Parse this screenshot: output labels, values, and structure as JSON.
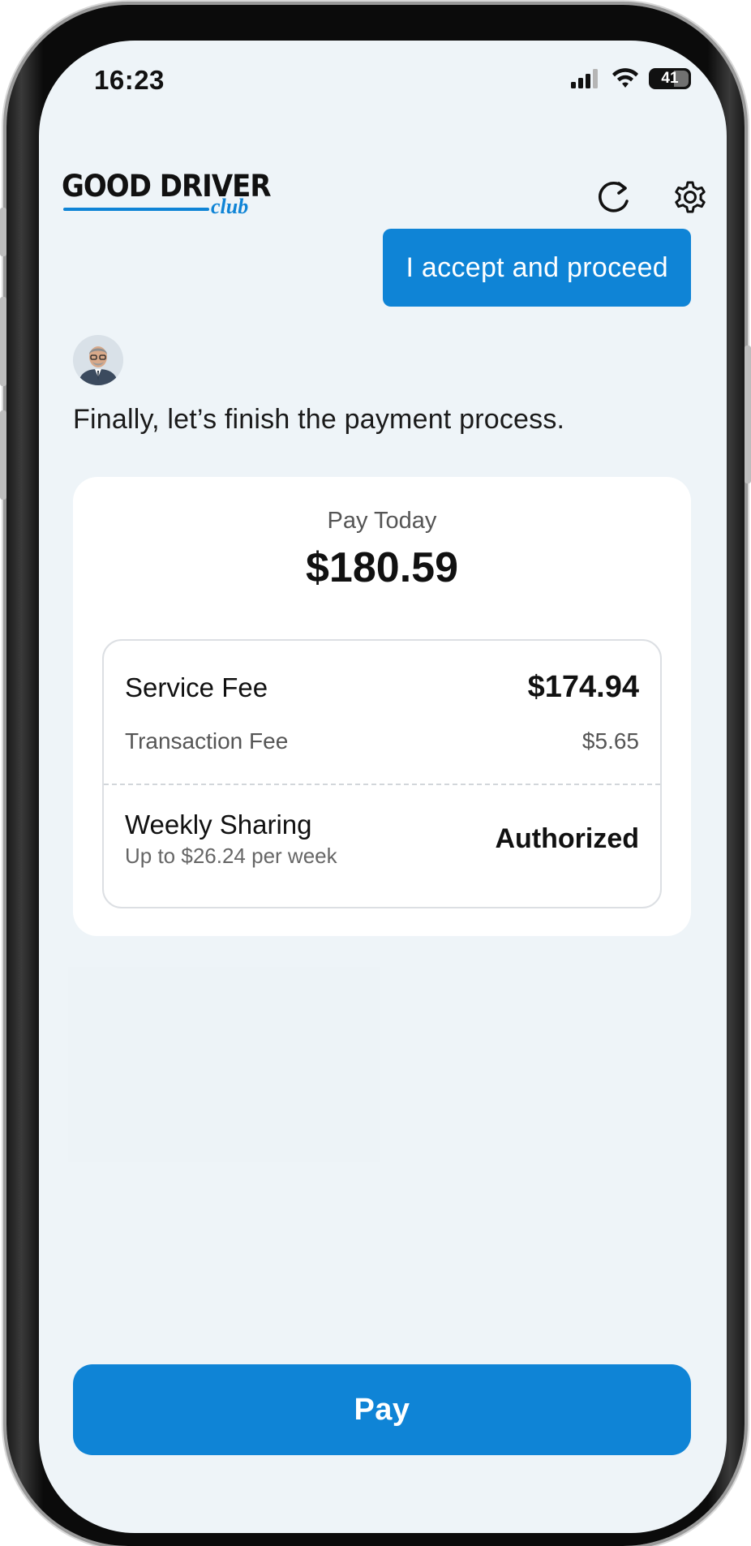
{
  "status_bar": {
    "time": "16:23",
    "battery": "41"
  },
  "header": {
    "logo_main": "GOOD DRIVER",
    "logo_sub": "club",
    "refresh_icon": "refresh-icon",
    "settings_icon": "gear-icon"
  },
  "chat": {
    "user_message": "I accept and proceed",
    "bot_message": "Finally, let’s finish the payment process."
  },
  "payment": {
    "pay_today_label": "Pay Today",
    "pay_today_amount": "$180.59",
    "service_fee_label": "Service Fee",
    "service_fee_value": "$174.94",
    "transaction_fee_label": "Transaction Fee",
    "transaction_fee_value": "$5.65",
    "weekly_sharing_label": "Weekly Sharing",
    "weekly_sharing_sub": "Up to $26.24 per week",
    "weekly_sharing_status": "Authorized"
  },
  "footer": {
    "pay_button": "Pay"
  },
  "colors": {
    "accent": "#0f84d6",
    "screen_bg": "#eef4f8",
    "card_bg": "#ffffff"
  }
}
